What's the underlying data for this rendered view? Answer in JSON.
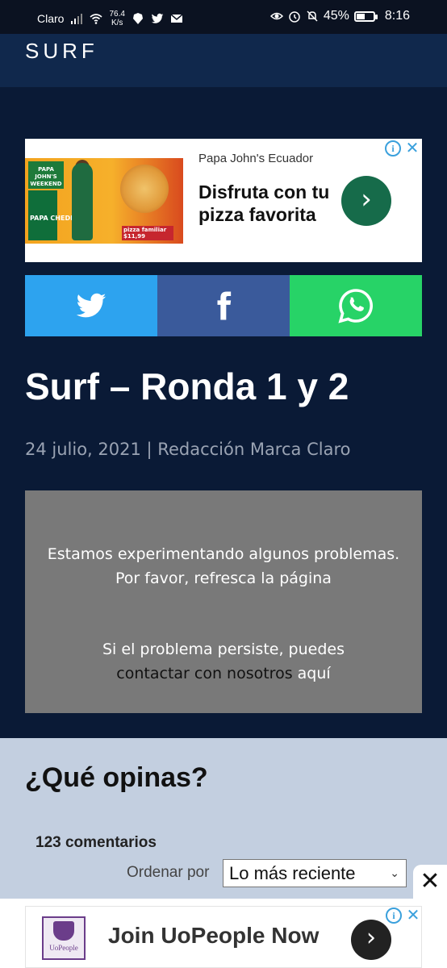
{
  "status_bar": {
    "carrier": "Claro",
    "speed_value": "76.4",
    "speed_unit": "K/s",
    "battery": "45%",
    "time": "8:16",
    "battery_level": 0.45
  },
  "header": {
    "site_title": "SURF"
  },
  "ad_top": {
    "brand": "Papa John's Ecuador",
    "headline": "Disfruta con tu pizza favorita",
    "cta_icon": "chevron-right-icon",
    "info_icon": "info-icon",
    "close_icon": "close-icon",
    "image": {
      "badge": "PAPA JOHN'S WEEKEND",
      "side_text": "PAPA CHEDDAR",
      "price_tag": "pizza familiar $11,99"
    }
  },
  "share": {
    "twitter_icon": "twitter-icon",
    "facebook_icon": "facebook-icon",
    "whatsapp_icon": "whatsapp-icon",
    "colors": {
      "twitter": "#2da3ef",
      "facebook": "#3a5a9b",
      "whatsapp": "#27d367"
    }
  },
  "article": {
    "title": "Surf – Ronda 1 y 2",
    "date": "24 julio, 2021",
    "separator": " | ",
    "author": "Redacción Marca Claro"
  },
  "error": {
    "line1": "Estamos experimentando algunos problemas.",
    "line2": "Por favor, refresca la página",
    "line3": "Si el problema persiste, puedes",
    "line4_prefix": "contactar con nosotros ",
    "line4_link": "aquí"
  },
  "comments": {
    "title": "¿Qué opinas?",
    "count": "123 comentarios",
    "sort_label": "Ordenar por",
    "sort_value": "Lo más reciente"
  },
  "ad_bottom": {
    "headline": "Join UoPeople Now",
    "logo_text": "UoPeople",
    "cta_icon": "chevron-right-icon"
  },
  "colors": {
    "page_bg": "#0a1a36",
    "header_bg": "#10284c",
    "error_bg": "#797979",
    "comments_bg": "#c3cfe0"
  }
}
